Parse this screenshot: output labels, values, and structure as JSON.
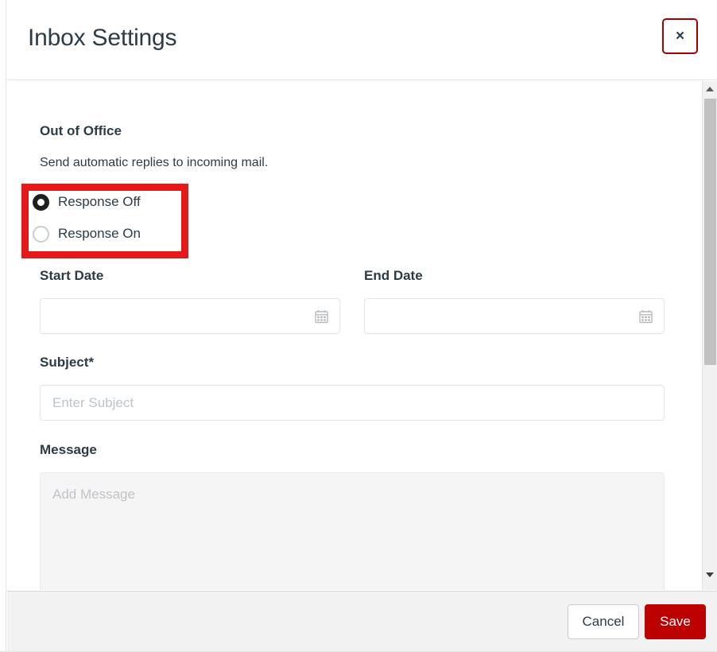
{
  "header": {
    "title": "Inbox Settings",
    "close_label": "×",
    "close_icon": "close-icon"
  },
  "body": {
    "section": {
      "title": "Out of Office",
      "description": "Send automatic replies to incoming mail."
    },
    "response_radio": {
      "options": [
        {
          "label": "Response Off",
          "selected": true
        },
        {
          "label": "Response On",
          "selected": false
        }
      ]
    },
    "fields": {
      "start_date": {
        "label": "Start Date",
        "value": "",
        "placeholder": "",
        "icon": "calendar-icon"
      },
      "end_date": {
        "label": "End Date",
        "value": "",
        "placeholder": "",
        "icon": "calendar-icon"
      },
      "subject": {
        "label": "Subject*",
        "value": "",
        "placeholder": "Enter Subject"
      },
      "message": {
        "label": "Message",
        "value": "",
        "placeholder": "Add Message"
      }
    }
  },
  "scrollbar": {
    "up_arrow": "scroll-up-arrow",
    "down_arrow": "scroll-down-arrow"
  },
  "footer": {
    "cancel_label": "Cancel",
    "save_label": "Save"
  },
  "colors": {
    "accent_red": "#bd0000",
    "annotation_red": "#e81818",
    "text": "#2d3b45",
    "border": "#e3e5e7",
    "footer_bg": "#f2f2f3",
    "textarea_bg": "#f5f5f5",
    "placeholder": "#bfc4c9"
  }
}
